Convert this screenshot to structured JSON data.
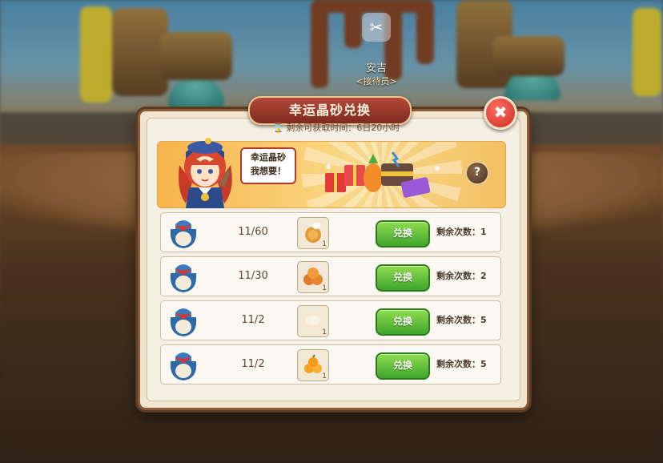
{
  "npc": {
    "name": "安吉",
    "role": "<接待员>"
  },
  "dialog": {
    "title": "幸运晶砂兑换",
    "close_symbol": "✖",
    "timer_label": "剩余可获取时间：",
    "timer_value": "6日20小时",
    "banner_text_line1": "幸运晶砂",
    "banner_text_line2": "我想要！",
    "help_symbol": "?"
  },
  "rows": [
    {
      "progress": "11/60",
      "item": "mooncake-box-icon",
      "count": "1",
      "button": "兑换",
      "remaining_label": "剩余次数：",
      "remaining": "1"
    },
    {
      "progress": "11/30",
      "item": "mooncakes-icon",
      "count": "1",
      "button": "兑换",
      "remaining_label": "剩余次数：",
      "remaining": "2"
    },
    {
      "progress": "11/2",
      "item": "steamed-bun-icon",
      "count": "1",
      "button": "兑换",
      "remaining_label": "剩余次数：",
      "remaining": "5"
    },
    {
      "progress": "11/2",
      "item": "oranges-icon",
      "count": "1",
      "button": "兑换",
      "remaining_label": "剩余次数：",
      "remaining": "5"
    }
  ],
  "colors": {
    "accent_button": "#4fb534",
    "title_tab": "#9a3a2c",
    "close": "#d9362a"
  }
}
